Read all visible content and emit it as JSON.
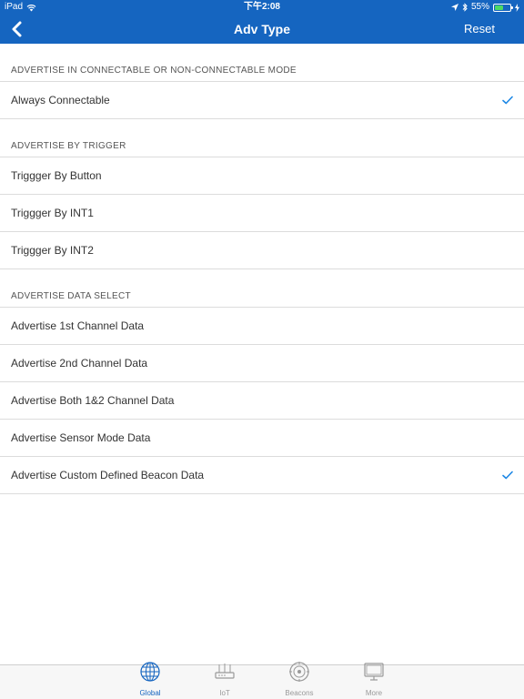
{
  "status_bar": {
    "device": "iPad",
    "time": "下午2:08",
    "battery": "55%",
    "battery_level": 0.55
  },
  "nav": {
    "title": "Adv Type",
    "reset_label": "Reset"
  },
  "sections": [
    {
      "header": "ADVERTISE IN CONNECTABLE OR NON-CONNECTABLE MODE",
      "items": [
        {
          "label": "Always Connectable",
          "checked": true
        }
      ]
    },
    {
      "header": "ADVERTISE BY TRIGGER",
      "items": [
        {
          "label": "Triggger By Button",
          "checked": false
        },
        {
          "label": "Triggger By INT1",
          "checked": false
        },
        {
          "label": "Triggger By INT2",
          "checked": false
        }
      ]
    },
    {
      "header": "ADVERTISE DATA SELECT",
      "items": [
        {
          "label": "Advertise 1st Channel Data",
          "checked": false
        },
        {
          "label": "Advertise 2nd Channel Data",
          "checked": false
        },
        {
          "label": "Advertise Both 1&2 Channel Data",
          "checked": false
        },
        {
          "label": "Advertise Sensor Mode Data",
          "checked": false
        },
        {
          "label": "Advertise Custom Defined Beacon Data",
          "checked": true
        }
      ]
    }
  ],
  "tabs": [
    {
      "label": "Global",
      "icon": "globe-icon",
      "active": true
    },
    {
      "label": "IoT",
      "icon": "router-icon",
      "active": false
    },
    {
      "label": "Beacons",
      "icon": "beacon-icon",
      "active": false
    },
    {
      "label": "More",
      "icon": "monitor-icon",
      "active": false
    }
  ],
  "colors": {
    "nav_bar": "#1565c0",
    "accent": "#1e88e5",
    "battery_fill": "#4cd964"
  }
}
